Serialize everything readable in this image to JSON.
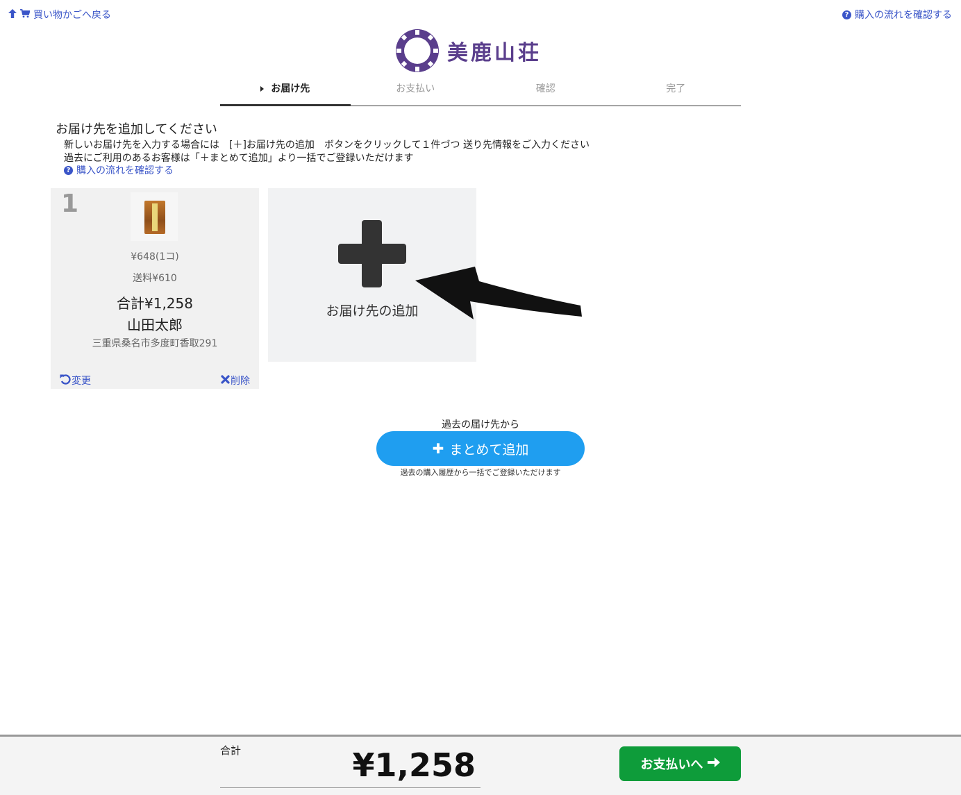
{
  "header": {
    "back_link": "買い物かごへ戻る",
    "help_link": "購入の流れを確認する",
    "brand_name": "美鹿山荘"
  },
  "steps": [
    {
      "label": "お届け先",
      "active": true
    },
    {
      "label": "お支払い",
      "active": false
    },
    {
      "label": "確認",
      "active": false
    },
    {
      "label": "完了",
      "active": false
    }
  ],
  "intro": {
    "heading": "お届け先を追加してください",
    "line1": "新しいお届け先を入力する場合には　[＋]お届け先の追加　ボタンをクリックして１件づつ 送り先情報をご入力ください",
    "line2": "過去にご利用のあるお客様は「＋まとめて追加」より一括でご登録いただけます",
    "help_link": "購入の流れを確認する"
  },
  "destinations": [
    {
      "number": "1",
      "price": "¥648(1コ)",
      "shipping": "送料¥610",
      "total": "合計¥1,258",
      "name": "山田太郎",
      "address": "三重県桑名市多度町香取291",
      "change_label": "変更",
      "delete_label": "削除"
    }
  ],
  "add_destination": {
    "label": "お届け先の追加"
  },
  "bulk": {
    "caption": "過去の届け先から",
    "button_label": "まとめて追加",
    "note": "過去の購入履歴から一括でご登録いただけます"
  },
  "footer": {
    "total_label": "合計",
    "total_value": "¥1,258",
    "pay_button": "お支払いへ"
  },
  "colors": {
    "link": "#3a55c8",
    "brand": "#5a3e8c",
    "bulk_button": "#1f9ef0",
    "pay_button": "#0e9c3a"
  }
}
